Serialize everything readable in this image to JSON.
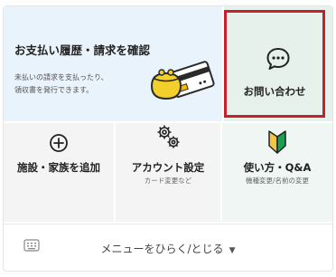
{
  "payment": {
    "title": "お支払い履歴・請求を確認",
    "desc_line1": "未払いの請求を支払ったり、",
    "desc_line2": "領収書を発行できます。",
    "icon": "wallet-card-icon"
  },
  "contact": {
    "label": "お問い合わせ",
    "icon": "chat-bubble-icon"
  },
  "add_facility": {
    "label": "施設・家族を追加",
    "icon": "plus-circle-icon"
  },
  "account": {
    "label": "アカウント設定",
    "sub": "カード変更など",
    "icon": "gears-icon"
  },
  "help": {
    "label": "使い方・Q&A",
    "sub": "機種変更/名前の変更",
    "icon": "beginner-mark-icon"
  },
  "menu_bar": {
    "label": "メニューをひらく/とじる",
    "caret": "▼",
    "icon": "keyboard-icon"
  },
  "colors": {
    "highlight": "#c8202a",
    "payment_bg": "#e8f3fb",
    "contact_bg": "#e6f1ec",
    "tile_bg": "#f4f4f4",
    "beginner_green": "#1f9d55",
    "beginner_yellow": "#f4c542"
  }
}
